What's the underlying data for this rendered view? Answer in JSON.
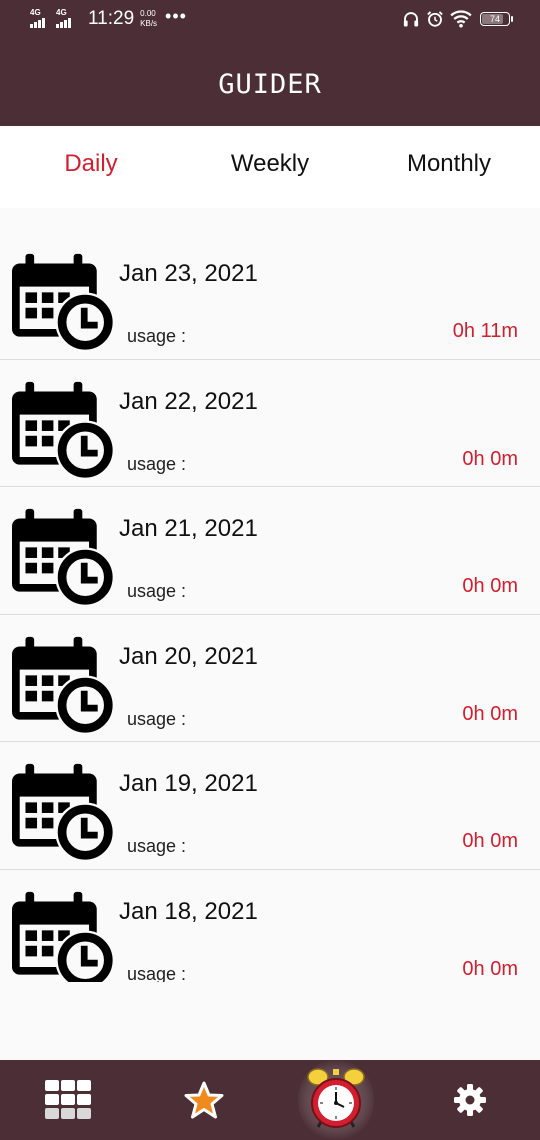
{
  "status_bar": {
    "network_1": "4G",
    "network_2": "4G",
    "time": "11:29",
    "speed_value": "0.00",
    "speed_unit": "KB/s",
    "more": "•••",
    "battery": "74"
  },
  "app_bar": {
    "title": "GUIDER"
  },
  "tabs": [
    {
      "label": "Daily",
      "active": true
    },
    {
      "label": "Weekly",
      "active": false
    },
    {
      "label": "Monthly",
      "active": false
    }
  ],
  "list": {
    "items": [
      {
        "date": "Jan 23, 2021",
        "usage_label": "usage :",
        "duration": "0h 11m"
      },
      {
        "date": "Jan 22, 2021",
        "usage_label": "usage :",
        "duration": "0h 0m"
      },
      {
        "date": "Jan 21, 2021",
        "usage_label": "usage :",
        "duration": "0h 0m"
      },
      {
        "date": "Jan 20, 2021",
        "usage_label": "usage :",
        "duration": "0h 0m"
      },
      {
        "date": "Jan 19, 2021",
        "usage_label": "usage :",
        "duration": "0h 0m"
      },
      {
        "date": "Jan 18, 2021",
        "usage_label": "usage :",
        "duration": "0h 0m"
      }
    ],
    "item_icon": "calendar-clock-icon"
  },
  "bottom_nav": {
    "items": [
      {
        "icon": "grid-icon"
      },
      {
        "icon": "star-icon"
      },
      {
        "icon": "alarm-clock-icon",
        "active": true
      },
      {
        "icon": "gear-icon"
      }
    ]
  },
  "colors": {
    "primary": "#4b2e36",
    "accent": "#d21f2f",
    "background": "#fafafa"
  }
}
